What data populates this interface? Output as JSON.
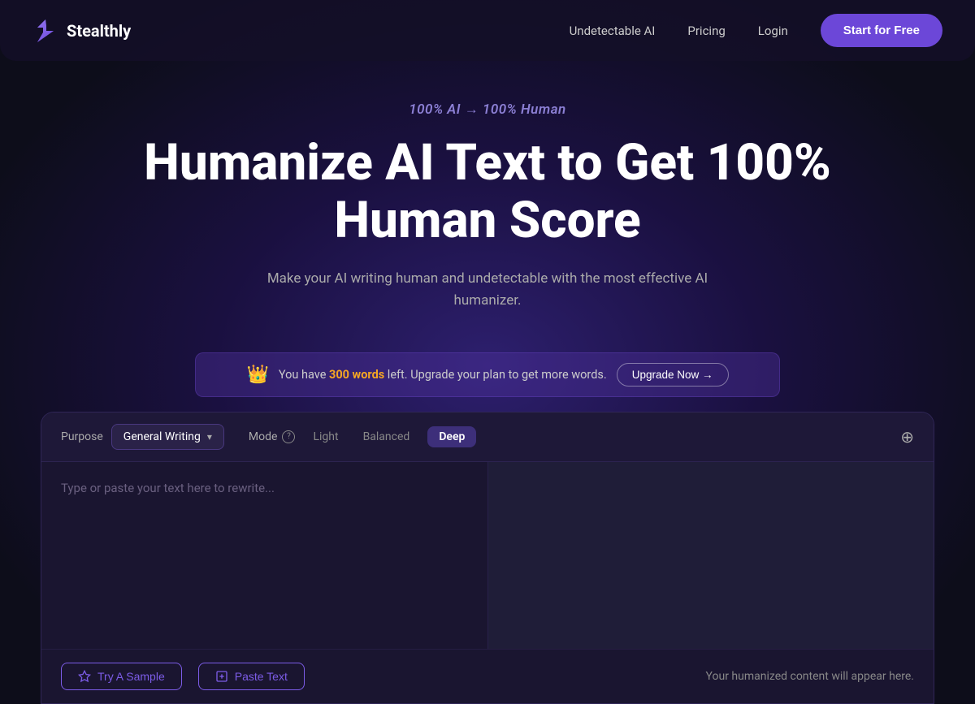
{
  "brand": {
    "name": "Stealthly",
    "logo_icon": "bolt"
  },
  "navbar": {
    "links": [
      {
        "label": "Undetectable AI",
        "url": "#"
      },
      {
        "label": "Pricing",
        "url": "#"
      },
      {
        "label": "Login",
        "url": "#"
      }
    ],
    "cta_label": "Start for Free"
  },
  "hero": {
    "badge": "100% AI → 100% Human",
    "title": "Humanize AI Text to Get 100% Human Score",
    "subtitle": "Make your AI writing human and undetectable with the most effective AI humanizer."
  },
  "upgrade_banner": {
    "crown_emoji": "👑",
    "text_before": "You have",
    "words_count": "300 words",
    "text_after": "left. Upgrade your plan to get more words.",
    "button_label": "Upgrade Now →"
  },
  "editor": {
    "toolbar": {
      "purpose_label": "Purpose",
      "purpose_value": "General Writing",
      "mode_label": "Mode",
      "modes": [
        {
          "label": "Light",
          "active": false
        },
        {
          "label": "Balanced",
          "active": false
        },
        {
          "label": "Deep",
          "active": true
        }
      ]
    },
    "input_placeholder": "Type or paste your text here to rewrite...",
    "output_placeholder": "Your humanized content will appear here.",
    "action_buttons": [
      {
        "label": "Try A Sample",
        "icon": "star"
      },
      {
        "label": "Paste Text",
        "icon": "plus"
      }
    ]
  }
}
